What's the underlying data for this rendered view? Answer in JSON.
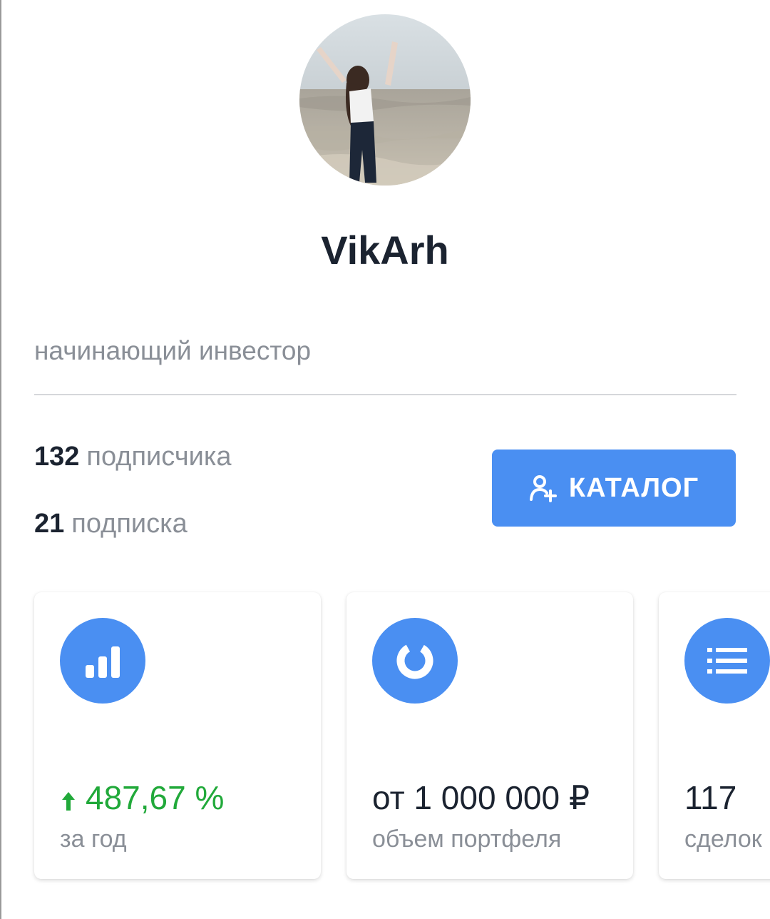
{
  "profile": {
    "username": "VikArh",
    "bio": "начинающий инвестор",
    "avatar_icon": "profile-photo"
  },
  "stats": {
    "followers_count": "132",
    "followers_label": "подписчика",
    "following_count": "21",
    "following_label": "подписка"
  },
  "catalog_button": {
    "label": "КАТАЛОГ",
    "icon": "add-user-icon"
  },
  "cards": [
    {
      "icon": "bar-chart-icon",
      "value": "487,67 %",
      "value_prefix_icon": "arrow-up-icon",
      "caption": "за год",
      "value_color": "#21a93a"
    },
    {
      "icon": "donut-chart-icon",
      "value": "от 1 000 000 ₽",
      "caption": "объем портфеля"
    },
    {
      "icon": "list-icon",
      "value": "117",
      "caption": "сделок"
    }
  ],
  "colors": {
    "accent": "#4a8ff2",
    "positive": "#21a93a",
    "text_primary": "#1b2330",
    "text_secondary": "#8a8f97"
  }
}
